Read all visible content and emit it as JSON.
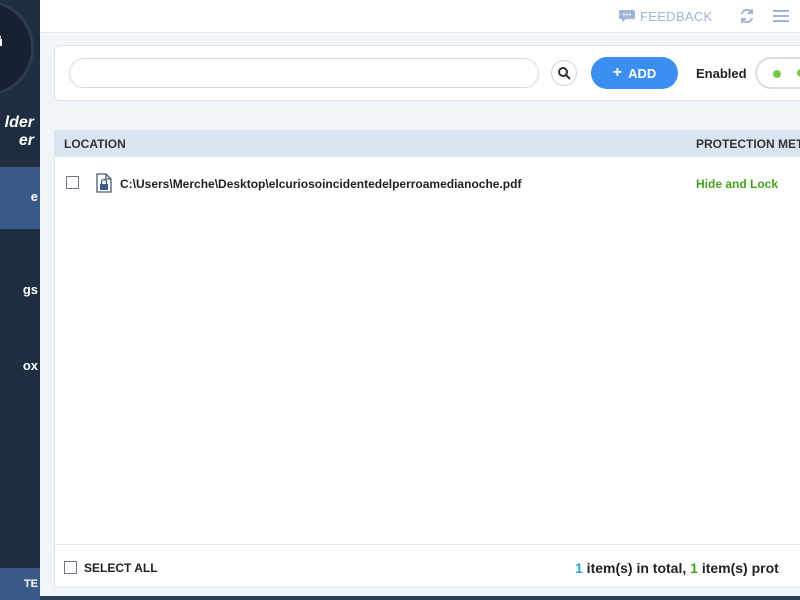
{
  "sidebar": {
    "brand_line1": "lder",
    "brand_line2": "er",
    "items": [
      {
        "label": "e",
        "active": true
      },
      {
        "label": "gs",
        "active": false
      },
      {
        "label": "ox",
        "active": false
      }
    ],
    "bottom_label": "TE"
  },
  "titlebar": {
    "feedback_label": "FEEDBACK",
    "feedback_icon": "chat-bubble-icon",
    "refresh_icon": "refresh-icon",
    "menu_icon": "hamburger-menu-icon"
  },
  "toolbar": {
    "search_value": "",
    "search_placeholder": "",
    "search_icon": "search-icon",
    "add_label": "ADD",
    "enabled_label": "Enabled",
    "toggle_state": "on"
  },
  "table": {
    "columns": [
      "LOCATION",
      "PROTECTION METHOD"
    ],
    "rows": [
      {
        "checked": false,
        "path": "C:\\Users\\Merche\\Desktop\\elcuriosoincidentedelperroamedianoche.pdf",
        "protection": "Hide and Lock"
      }
    ]
  },
  "footer": {
    "select_all_label": "SELECT ALL",
    "total_count": "1",
    "total_text": " item(s) in total, ",
    "protected_count": "1",
    "protected_text": " item(s) prot"
  },
  "colors": {
    "sidebar_bg": "#1f2d40",
    "sidebar_active": "#3a5a89",
    "accent_blue": "#3b8ff0",
    "protection_green": "#44a31e",
    "count_blue": "#2ea3c7"
  }
}
